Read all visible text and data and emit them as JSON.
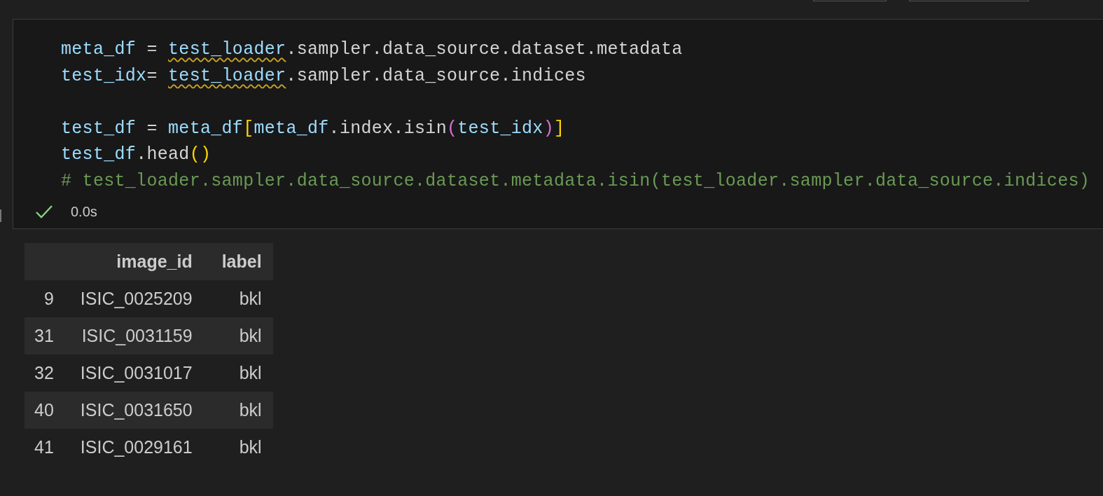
{
  "code_cell": {
    "blocks": [
      [
        [
          {
            "text": "meta_df",
            "kind": "var"
          },
          {
            "text": " = ",
            "kind": "plain"
          },
          {
            "text": "test_loader",
            "kind": "var",
            "warning": true
          },
          {
            "text": ".sampler.data_source.dataset.metadata",
            "kind": "plain"
          }
        ],
        [
          {
            "text": "test_idx",
            "kind": "var"
          },
          {
            "text": "= ",
            "kind": "plain"
          },
          {
            "text": "test_loader",
            "kind": "var",
            "warning": true
          },
          {
            "text": ".sampler.data_source.indices",
            "kind": "plain"
          }
        ]
      ],
      [
        [
          {
            "text": "test_df",
            "kind": "var"
          },
          {
            "text": " = ",
            "kind": "plain"
          },
          {
            "text": "meta_df",
            "kind": "var"
          },
          {
            "text": "[",
            "kind": "bracket1"
          },
          {
            "text": "meta_df",
            "kind": "var"
          },
          {
            "text": ".index.isin",
            "kind": "plain"
          },
          {
            "text": "(",
            "kind": "bracket2"
          },
          {
            "text": "test_idx",
            "kind": "var"
          },
          {
            "text": ")",
            "kind": "bracket2"
          },
          {
            "text": "]",
            "kind": "bracket1"
          }
        ],
        [
          {
            "text": "test_df",
            "kind": "var"
          },
          {
            "text": ".head",
            "kind": "plain"
          },
          {
            "text": "()",
            "kind": "bracket1"
          }
        ],
        [
          {
            "text": "# test_loader.sampler.data_source.dataset.metadata.isin(test_loader.sampler.data_source.indices)",
            "kind": "comment"
          }
        ]
      ]
    ],
    "status": {
      "succeeded": true,
      "duration": "0.0s"
    }
  },
  "output_table": {
    "columns": [
      "",
      "image_id",
      "label"
    ],
    "rows": [
      {
        "cells": [
          "9",
          "ISIC_0025209",
          "bkl"
        ]
      },
      {
        "cells": [
          "31",
          "ISIC_0031159",
          "bkl"
        ]
      },
      {
        "cells": [
          "32",
          "ISIC_0031017",
          "bkl"
        ]
      },
      {
        "cells": [
          "40",
          "ISIC_0031650",
          "bkl"
        ]
      },
      {
        "cells": [
          "41",
          "ISIC_0029161",
          "bkl"
        ]
      }
    ]
  }
}
